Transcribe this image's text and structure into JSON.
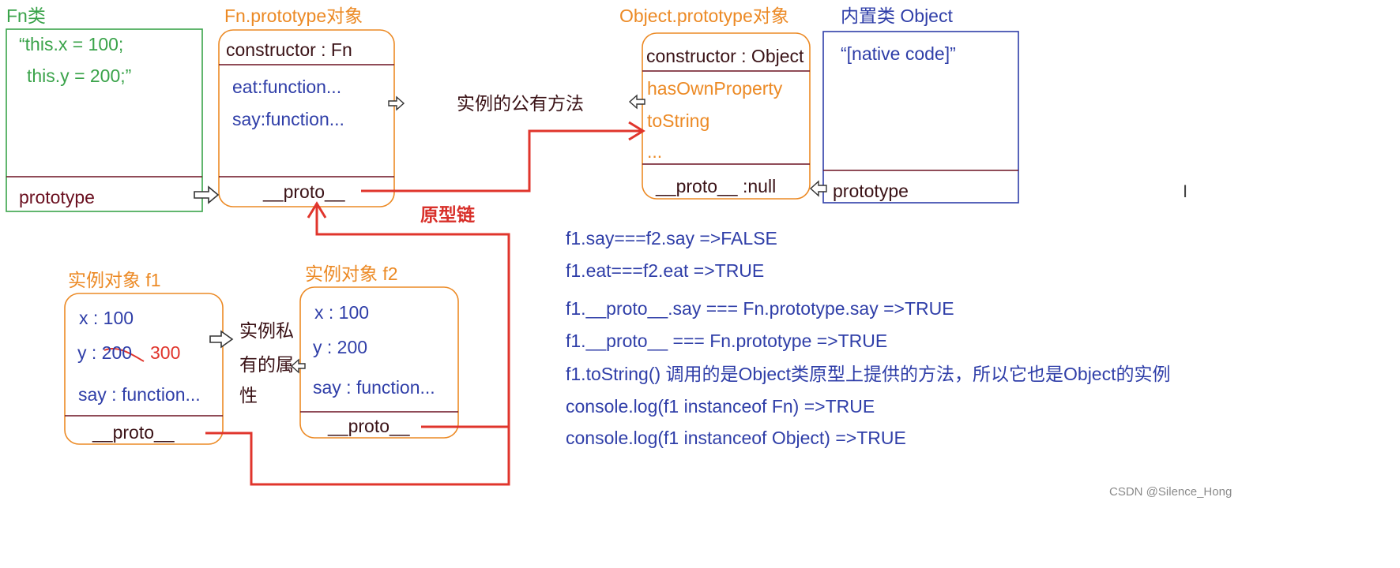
{
  "fn_class": {
    "title": "Fn类",
    "body_lines": [
      "“this.x = 100;",
      "this.y = 200;”"
    ],
    "footer": "prototype"
  },
  "fn_prototype": {
    "title": "Fn.prototype对象",
    "constructor": "constructor : Fn",
    "methods": [
      "eat:function...",
      "say:function..."
    ],
    "proto": "__proto__"
  },
  "public_methods_label": "实例的公有方法",
  "object_prototype": {
    "title": "Object.prototype对象",
    "constructor": "constructor : Object",
    "methods": [
      "hasOwnProperty",
      "toString",
      "..."
    ],
    "proto": "__proto__ :null"
  },
  "builtin_object": {
    "title": "内置类 Object",
    "body": "“[native code]”",
    "footer": "prototype"
  },
  "prototype_chain_label": "原型链",
  "instance_f1": {
    "title": "实例对象  f1",
    "x": "x : 100",
    "y": "y : 200",
    "y_new": "300",
    "say": "say : function...",
    "proto": "__proto__"
  },
  "private_label_lines": [
    "实例私",
    "有的属",
    "性"
  ],
  "instance_f2": {
    "title": "实例对象  f2",
    "x": "x : 100",
    "y": "y : 200",
    "say": "say : function...",
    "proto": "__proto__"
  },
  "notes": [
    "f1.say===f2.say   =>FALSE",
    "f1.eat===f2.eat    =>TRUE",
    "f1.__proto__.say  === Fn.prototype.say    =>TRUE",
    "f1.__proto__  === Fn.prototype    =>TRUE",
    "f1.toString()   调用的是Object类原型上提供的方法，所以它也是Object的实例",
    "console.log(f1 instanceof Fn)    =>TRUE",
    "console.log(f1 instanceof Object)    =>TRUE"
  ],
  "watermark": "CSDN @Silence_Hong",
  "colors": {
    "orange": "#ec8a25",
    "green": "#3aa34a",
    "blue": "#2f3ea8",
    "maroon": "#6b1020",
    "red": "#e0352c"
  }
}
